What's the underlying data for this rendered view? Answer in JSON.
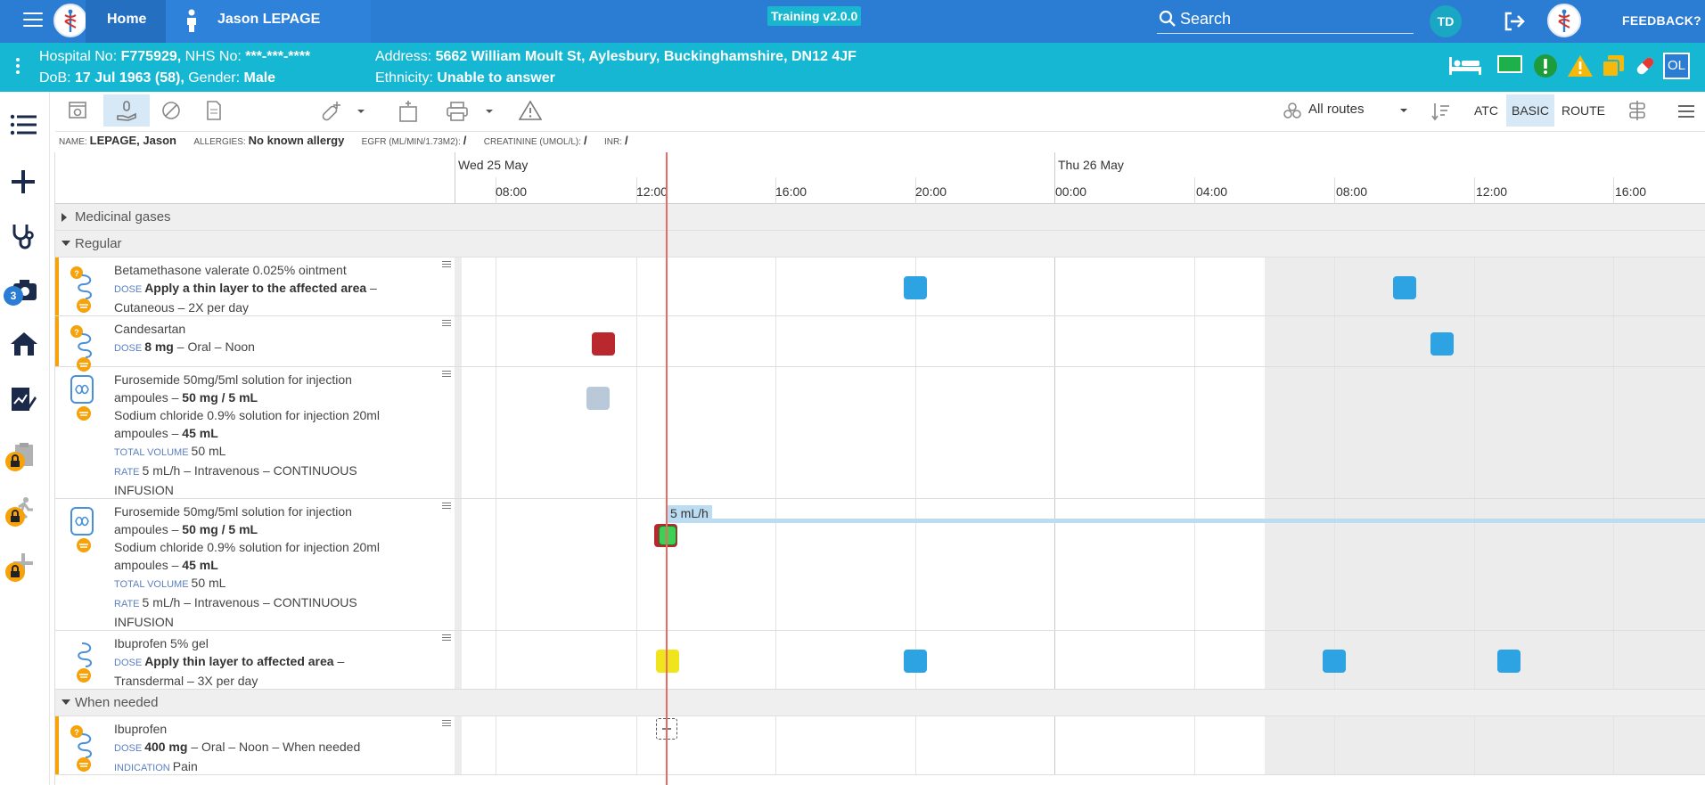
{
  "topbar": {
    "home_label": "Home",
    "patient_name": "Jason LEPAGE",
    "environment": "Training v2.0.0",
    "search_placeholder": "Search",
    "user_initials": "TD",
    "feedback_label": "FEEDBACK?"
  },
  "banner": {
    "hospital_no_label": "Hospital No:",
    "hospital_no": "F775929,",
    "nhs_no_label": "NHS No:",
    "nhs_no": "***-***-****",
    "dob_label": "DoB:",
    "dob": "17 Jul 1963 (58),",
    "gender_label": "Gender:",
    "gender": "Male",
    "address_label": "Address:",
    "address": "5662 William Moult St, Aylesbury, Buckinghamshire, DN12 4JF",
    "ethnicity_label": "Ethnicity:",
    "ethnicity": "Unable to answer",
    "ol_badge": "OL"
  },
  "rail": {
    "camera_badge": "3"
  },
  "toolbar": {
    "routes_label": "All routes",
    "atc": "ATC",
    "basic": "BASIC",
    "route": "ROUTE"
  },
  "infoline": {
    "name_label": "NAME:",
    "name": "LEPAGE, Jason",
    "allergies_label": "ALLERGIES:",
    "allergies": "No known allergy",
    "egfr_label": "EGFR (ML/MIN/1.73M2):",
    "egfr": "/",
    "creatinine_label": "CREATININE (UMOL/L):",
    "creatinine": "/",
    "inr_label": "INR:",
    "inr": "/"
  },
  "timeline": {
    "days": [
      "Wed 25 May",
      "Thu 26 May"
    ],
    "ticks": [
      "08:00",
      "12:00",
      "16:00",
      "20:00",
      "00:00",
      "04:00",
      "08:00",
      "12:00",
      "16:00"
    ]
  },
  "groups": {
    "gases": "Medicinal gases",
    "regular": "Regular",
    "when_needed": "When needed"
  },
  "meds": [
    {
      "l1": "Betamethasone valerate 0.025% ointment",
      "dose_label": "DOSE",
      "dose": "Apply a thin layer to the affected area",
      "tail": " –",
      "l3": "Cutaneous – 2X per day"
    },
    {
      "l1": "Candesartan",
      "dose_label": "DOSE",
      "dose": "8 mg",
      "tail": " – Oral – Noon"
    },
    {
      "l1": "Furosemide 50mg/5ml solution for injection",
      "l2a": "ampoules – ",
      "l2b": "50 mg / 5 mL",
      "l3": "Sodium chloride 0.9% solution for injection 20ml",
      "l4a": "ampoules – ",
      "l4b": "45 mL",
      "tv_label": "TOTAL VOLUME",
      "tv": "50 mL",
      "rate_label": "RATE",
      "rate": "5 mL/h – Intravenous – CONTINUOUS",
      "l7": "INFUSION"
    },
    {
      "l1": "Furosemide 50mg/5ml solution for injection",
      "l2a": "ampoules – ",
      "l2b": "50 mg / 5 mL",
      "l3": "Sodium chloride 0.9% solution for injection 20ml",
      "l4a": "ampoules – ",
      "l4b": "45 mL",
      "tv_label": "TOTAL VOLUME",
      "tv": "50 mL",
      "rate_label": "RATE",
      "rate": "5 mL/h – Intravenous – CONTINUOUS",
      "l7": "INFUSION",
      "infusion_label": "5 mL/h"
    },
    {
      "l1": "Ibuprofen 5% gel",
      "dose_label": "DOSE",
      "dose": "Apply thin layer to affected area",
      "tail": " –",
      "l3": "Transdermal – 3X per day"
    },
    {
      "l1": "Ibuprofen",
      "dose_label": "DOSE",
      "dose": "400 mg",
      "tail": " – Oral – Noon – When needed",
      "ind_label": "INDICATION",
      "ind": "Pain"
    }
  ],
  "colors": {
    "topbar": "#2b7cd3",
    "banner": "#16b7d2",
    "dose_planned": "#2ea3e4",
    "dose_missed": "#b9282c",
    "dose_given": "#3ecf55",
    "dose_due": "#f0e41c",
    "dose_pending": "#b9c9d9",
    "now_line": "#e96b64"
  }
}
